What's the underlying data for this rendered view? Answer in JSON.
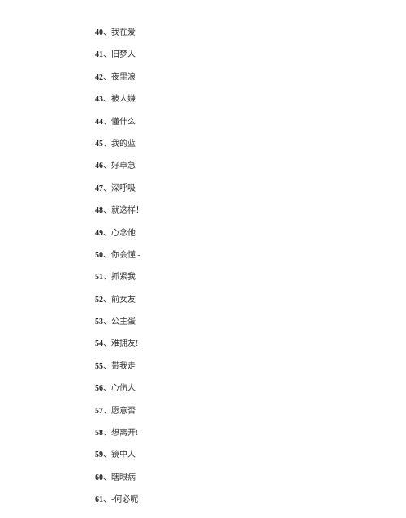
{
  "items": [
    {
      "num": "40",
      "text": "我在爱"
    },
    {
      "num": "41",
      "text": "旧梦人"
    },
    {
      "num": "42",
      "text": "夜里浪"
    },
    {
      "num": "43",
      "text": "被人嫌"
    },
    {
      "num": "44",
      "text": "懂什么"
    },
    {
      "num": "45",
      "text": "我的蓝"
    },
    {
      "num": "46",
      "text": "好卓急"
    },
    {
      "num": "47",
      "text": "深呼吸"
    },
    {
      "num": "48",
      "text": "就这样！"
    },
    {
      "num": "49",
      "text": "心念他"
    },
    {
      "num": "50",
      "text": "你会懂 -"
    },
    {
      "num": "51",
      "text": "抓紧我"
    },
    {
      "num": "52",
      "text": "前女友"
    },
    {
      "num": "53",
      "text": "公主蛋"
    },
    {
      "num": "54",
      "text": "难拥友!"
    },
    {
      "num": "55",
      "text": "带我走"
    },
    {
      "num": "56",
      "text": "心伤人"
    },
    {
      "num": "57",
      "text": "愿意否"
    },
    {
      "num": "58",
      "text": "想离开!"
    },
    {
      "num": "59",
      "text": "镜中人"
    },
    {
      "num": "60",
      "text": "瞎眼病"
    },
    {
      "num": "61",
      "text": "-何必呢"
    }
  ],
  "separator": "、"
}
